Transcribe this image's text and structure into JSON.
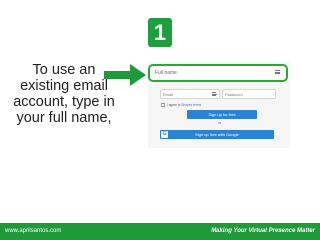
{
  "step": {
    "number": "1"
  },
  "instruction": "To use an existing email account, type in your full name,",
  "form": {
    "full_name_placeholder": "Full name",
    "email_placeholder": "Email",
    "password_placeholder": "Password",
    "agree_text": "I agree to",
    "agree_link": "Shopee terms",
    "signup_label": "Sign up for free",
    "or_text": "or",
    "google_label": "Sign up free with Google",
    "field_icon": "contact-card-icon",
    "google_icon": "google-logo-icon"
  },
  "footer": {
    "left_text": "www.aprilsantos.com",
    "right_text": "Making Your Virtual Presence Matter"
  },
  "colors": {
    "brand_green": "#1f9a3b",
    "highlight_green": "#31a53a",
    "button_blue": "#2b83d6"
  }
}
